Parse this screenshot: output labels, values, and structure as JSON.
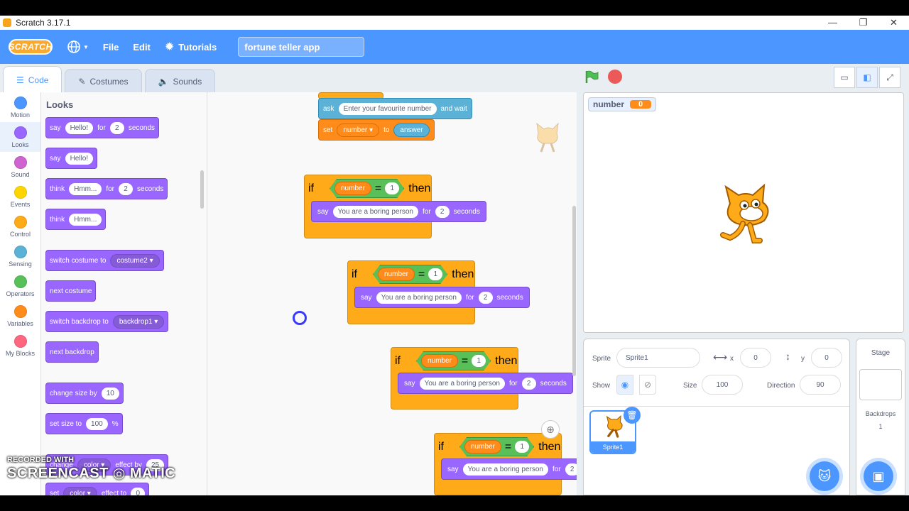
{
  "window": {
    "title": "Scratch 3.17.1",
    "minimize": "—",
    "maximize": "❐",
    "close": "✕"
  },
  "menu": {
    "logo": "SCRATCH",
    "file": "File",
    "edit": "Edit",
    "tutorials": "Tutorials",
    "project_title": "fortune teller app"
  },
  "tabs": {
    "code": "Code",
    "costumes": "Costumes",
    "sounds": "Sounds"
  },
  "categories": [
    {
      "label": "Motion",
      "color": "#4c97ff"
    },
    {
      "label": "Looks",
      "color": "#9966ff"
    },
    {
      "label": "Sound",
      "color": "#cf63cf"
    },
    {
      "label": "Events",
      "color": "#ffd500"
    },
    {
      "label": "Control",
      "color": "#ffab19"
    },
    {
      "label": "Sensing",
      "color": "#5cb1d6"
    },
    {
      "label": "Operators",
      "color": "#59c059"
    },
    {
      "label": "Variables",
      "color": "#ff8c1a"
    },
    {
      "label": "My Blocks",
      "color": "#ff6680"
    }
  ],
  "palette": {
    "title": "Looks",
    "say_for": {
      "say": "say",
      "text": "Hello!",
      "for": "for",
      "num": "2",
      "seconds": "seconds"
    },
    "say": {
      "say": "say",
      "text": "Hello!"
    },
    "think_for": {
      "think": "think",
      "text": "Hmm...",
      "for": "for",
      "num": "2",
      "seconds": "seconds"
    },
    "think": {
      "think": "think",
      "text": "Hmm..."
    },
    "switch_costume": {
      "label": "switch costume to",
      "value": "costume2"
    },
    "next_costume": "next costume",
    "switch_backdrop": {
      "label": "switch backdrop to",
      "value": "backdrop1"
    },
    "next_backdrop": "next backdrop",
    "change_size": {
      "label": "change size by",
      "value": "10"
    },
    "set_size": {
      "label": "set size to",
      "value": "100",
      "unit": "%"
    },
    "change_effect": {
      "change": "change",
      "effect": "color",
      "by": "effect by",
      "value": "25"
    },
    "set_effect": {
      "set": "set",
      "effect": "color",
      "to": "effect to",
      "value": "0"
    }
  },
  "code": {
    "ask": {
      "label": "ask",
      "prompt": "Enter your favourite number",
      "wait": "and wait"
    },
    "set": {
      "label": "set",
      "var": "number",
      "to": "to",
      "value": "answer"
    },
    "if_blocks": [
      {
        "if": "if",
        "var": "number",
        "eq": "=",
        "value": "1",
        "then": "then",
        "say": "say",
        "text": "You are a boring person",
        "for": "for",
        "secs": "2",
        "seconds": "seconds"
      },
      {
        "if": "if",
        "var": "number",
        "eq": "=",
        "value": "1",
        "then": "then",
        "say": "say",
        "text": "You are a boring person",
        "for": "for",
        "secs": "2",
        "seconds": "seconds"
      },
      {
        "if": "if",
        "var": "number",
        "eq": "=",
        "value": "1",
        "then": "then",
        "say": "say",
        "text": "You are a boring person",
        "for": "for",
        "secs": "2",
        "seconds": "seconds"
      },
      {
        "if": "if",
        "var": "number",
        "eq": "=",
        "value": "1",
        "then": "then",
        "say": "say",
        "text": "You are a boring person",
        "for": "for",
        "secs": "2",
        "seconds": ""
      }
    ]
  },
  "stage": {
    "monitor_label": "number",
    "monitor_value": "0"
  },
  "sprite_info": {
    "sprite_label": "Sprite",
    "sprite_name": "Sprite1",
    "x_label": "x",
    "x": "0",
    "y_label": "y",
    "y": "0",
    "show_label": "Show",
    "size_label": "Size",
    "size": "100",
    "direction_label": "Direction",
    "direction": "90"
  },
  "sprites": [
    {
      "name": "Sprite1"
    }
  ],
  "stage_pane": {
    "title": "Stage",
    "backdrops_label": "Backdrops",
    "backdrops_count": "1"
  },
  "watermark": {
    "line1": "RECORDED WITH",
    "line2": "SCREENCAST",
    "line3": "MATIC"
  }
}
